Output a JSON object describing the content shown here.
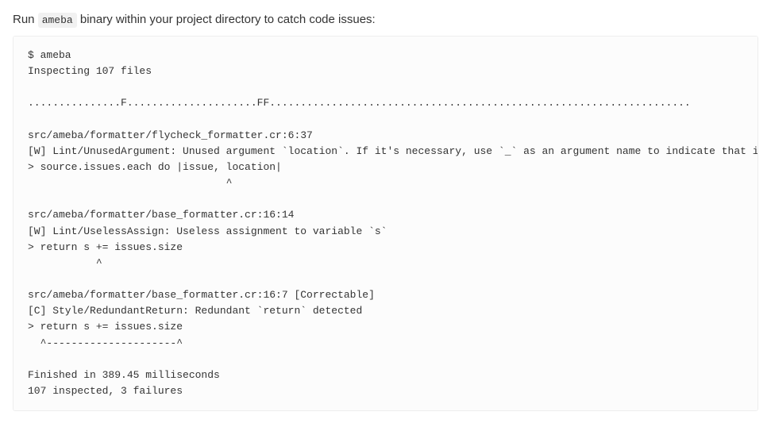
{
  "intro": {
    "before": "Run ",
    "code": "ameba",
    "after": " binary within your project directory to catch code issues:"
  },
  "terminal": {
    "output": "$ ameba\nInspecting 107 files\n\n...............F.....................FF....................................................................\n\nsrc/ameba/formatter/flycheck_formatter.cr:6:37\n[W] Lint/UnusedArgument: Unused argument `location`. If it's necessary, use `_` as an argument name to indicate that it won't be used.\n> source.issues.each do |issue, location|\n                                ^\n\nsrc/ameba/formatter/base_formatter.cr:16:14\n[W] Lint/UselessAssign: Useless assignment to variable `s`\n> return s += issues.size\n           ^\n\nsrc/ameba/formatter/base_formatter.cr:16:7 [Correctable]\n[C] Style/RedundantReturn: Redundant `return` detected\n> return s += issues.size\n  ^---------------------^\n\nFinished in 389.45 milliseconds\n107 inspected, 3 failures"
  }
}
